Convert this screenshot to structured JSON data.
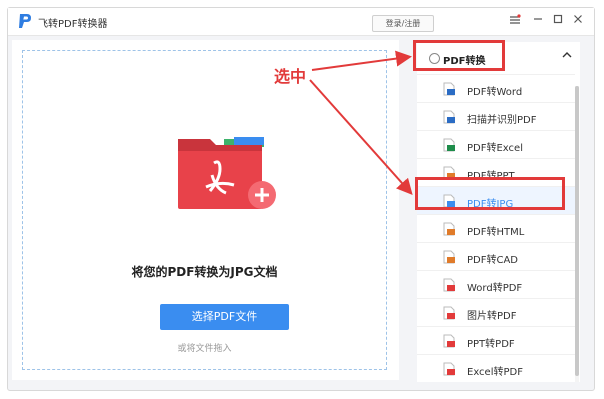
{
  "app": {
    "title": "飞转PDF转换器",
    "login_label": "登录/注册"
  },
  "window_controls": {
    "menu_icon": "menu-icon",
    "minimize_icon": "minimize-icon",
    "maximize_icon": "maximize-icon",
    "close_icon": "close-icon"
  },
  "main": {
    "heading": "将您的PDF转换为JPG文档",
    "select_button": "选择PDF文件",
    "drag_hint": "或将文件拖入"
  },
  "sidebar": {
    "section_title": "PDF转换",
    "items": [
      {
        "label": "PDF转Word",
        "icon": "word-file-icon",
        "color": "#2b6cc4",
        "active": false
      },
      {
        "label": "扫描并识别PDF",
        "icon": "scan-file-icon",
        "color": "#2b6cc4",
        "active": false
      },
      {
        "label": "PDF转Excel",
        "icon": "excel-file-icon",
        "color": "#1e8c4a",
        "active": false
      },
      {
        "label": "PDF转PPT",
        "icon": "ppt-file-icon",
        "color": "#e07b2a",
        "active": false
      },
      {
        "label": "PDF转JPG",
        "icon": "jpg-file-icon",
        "color": "#3a8df0",
        "active": true
      },
      {
        "label": "PDF转HTML",
        "icon": "html-file-icon",
        "color": "#e07b2a",
        "active": false
      },
      {
        "label": "PDF转CAD",
        "icon": "cad-file-icon",
        "color": "#e07b2a",
        "active": false
      },
      {
        "label": "Word转PDF",
        "icon": "pdf-file-icon",
        "color": "#e23a3a",
        "active": false
      },
      {
        "label": "图片转PDF",
        "icon": "pdf-file-icon",
        "color": "#e23a3a",
        "active": false
      },
      {
        "label": "PPT转PDF",
        "icon": "pdf-file-icon",
        "color": "#e23a3a",
        "active": false
      },
      {
        "label": "Excel转PDF",
        "icon": "pdf-file-icon",
        "color": "#e23a3a",
        "active": false
      }
    ]
  },
  "annotation": {
    "label": "选中",
    "color": "#e23a3a"
  },
  "colors": {
    "accent": "#3a8df0",
    "folder": "#e8424a",
    "dashed_border": "#9ec3e8"
  }
}
